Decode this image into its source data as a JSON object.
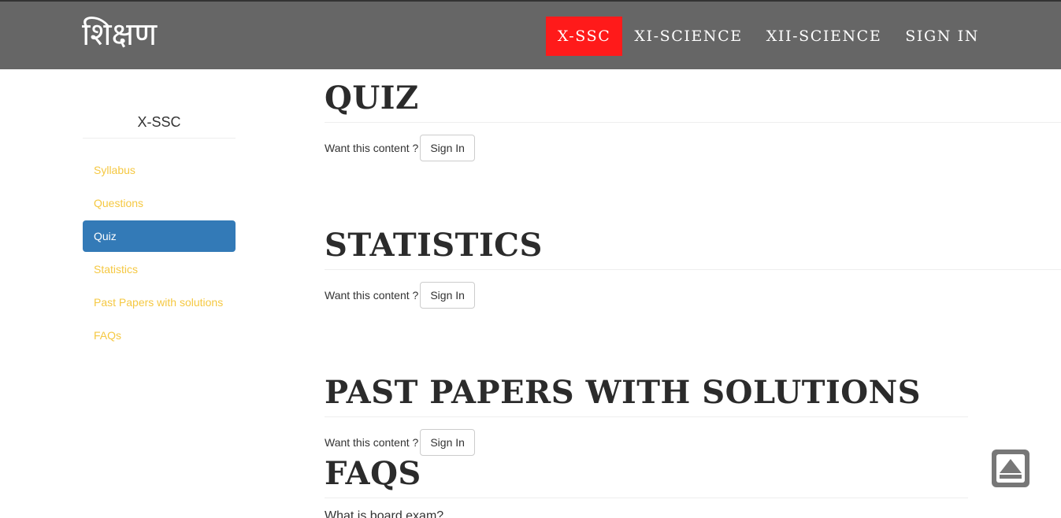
{
  "brand": "शिक्षण",
  "nav": [
    {
      "label": "X-SSC",
      "active": true
    },
    {
      "label": "XI-SCIENCE",
      "active": false
    },
    {
      "label": "XII-SCIENCE",
      "active": false
    },
    {
      "label": "SIGN IN",
      "active": false
    }
  ],
  "sidebar": {
    "title": "X-SSC",
    "items": [
      {
        "label": "Syllabus",
        "active": false
      },
      {
        "label": "Questions",
        "active": false
      },
      {
        "label": "Quiz",
        "active": true
      },
      {
        "label": "Statistics",
        "active": false
      },
      {
        "label": "Past Papers with solutions",
        "active": false
      },
      {
        "label": "FAQs",
        "active": false
      }
    ]
  },
  "sections": [
    {
      "title": "QUIZ",
      "prompt": "Want this content ?",
      "button": "Sign In"
    },
    {
      "title": "STATISTICS",
      "prompt": "Want this content ?",
      "button": "Sign In"
    },
    {
      "title": "PAST PAPERS WITH SOLUTIONS",
      "prompt": "Want this content ?",
      "button": "Sign In"
    },
    {
      "title": "FAQS",
      "preview": "What is board exam?"
    }
  ],
  "colors": {
    "header_bg": "#666666",
    "nav_active": "#ff1a1a",
    "sidebar_active": "#337ab7",
    "sidebar_link": "#f5c842"
  },
  "icons": {
    "scroll_top": "scroll-to-top-icon"
  }
}
